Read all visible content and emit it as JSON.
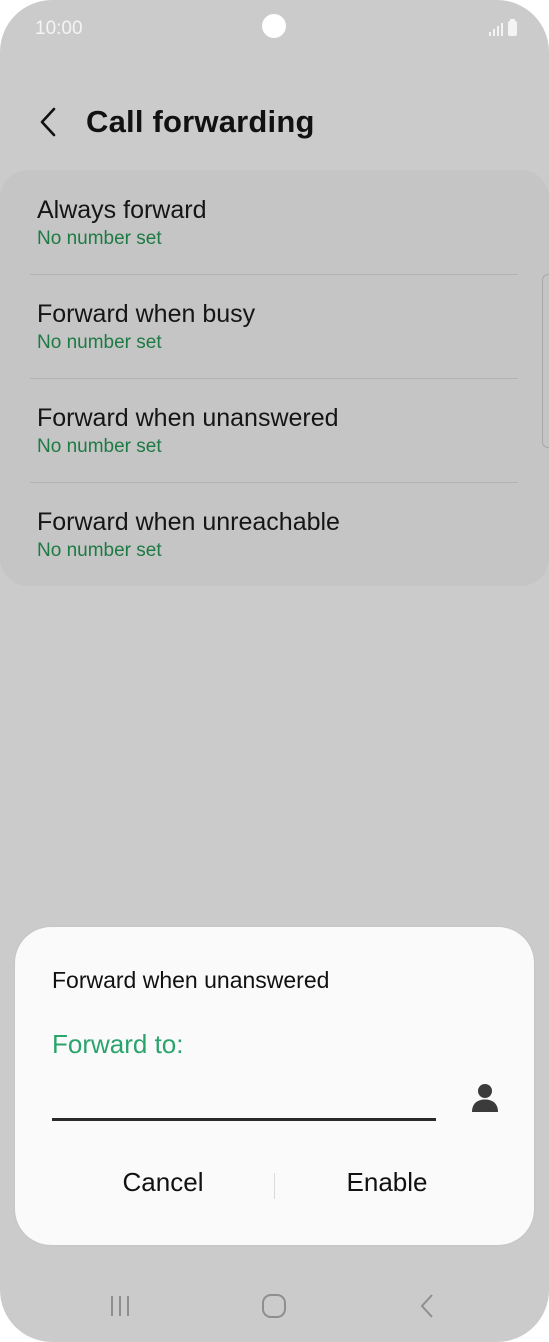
{
  "status_bar": {
    "time": "10:00"
  },
  "header": {
    "title": "Call forwarding"
  },
  "options": [
    {
      "title": "Always forward",
      "subtitle": "No number set"
    },
    {
      "title": "Forward when busy",
      "subtitle": "No number set"
    },
    {
      "title": "Forward when unanswered",
      "subtitle": "No number set"
    },
    {
      "title": "Forward when unreachable",
      "subtitle": "No number set"
    }
  ],
  "dialog": {
    "title": "Forward when unanswered",
    "field_label": "Forward to:",
    "field_value": "",
    "cancel_label": "Cancel",
    "enable_label": "Enable"
  },
  "icons": {
    "back": "back-arrow-icon",
    "contact": "contact-person-icon",
    "nav_recents": "recents-icon",
    "nav_home": "home-icon",
    "nav_back": "nav-back-icon"
  },
  "colors": {
    "accent": "#2aa36c",
    "subtitle": "#1e7a43",
    "background": "#cbcbcb",
    "dialog": "#fafafa"
  }
}
